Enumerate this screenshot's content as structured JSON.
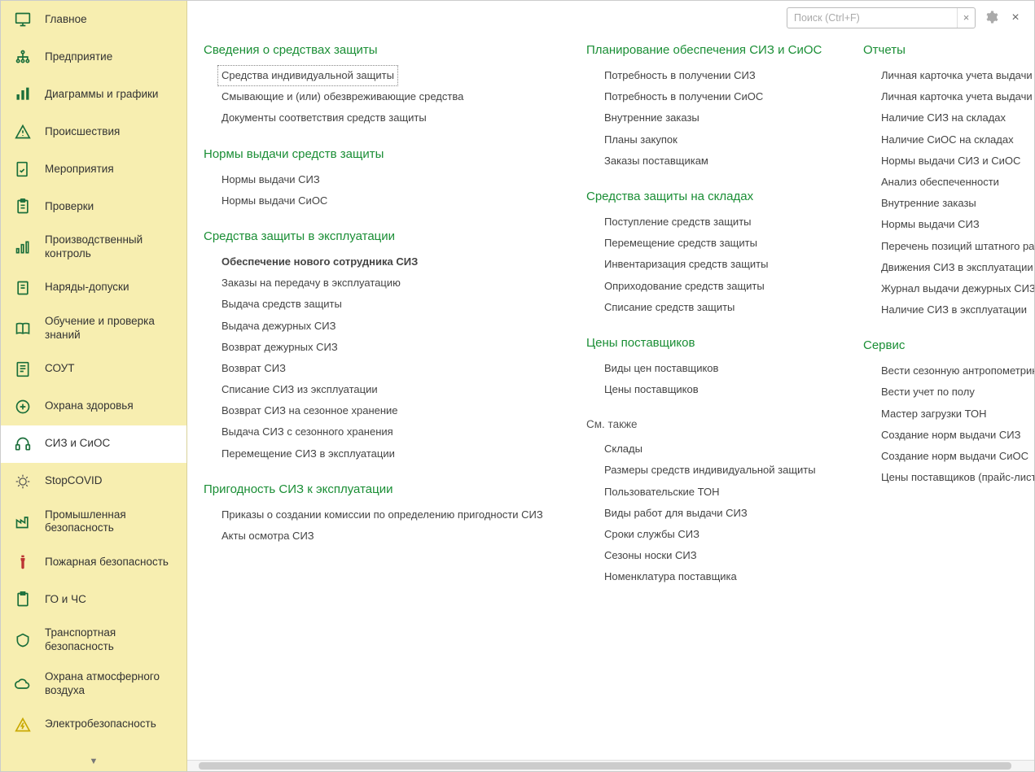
{
  "search": {
    "placeholder": "Поиск (Ctrl+F)"
  },
  "sidebar": {
    "items": [
      {
        "label": "Главное",
        "icon": "monitor"
      },
      {
        "label": "Предприятие",
        "icon": "org"
      },
      {
        "label": "Диаграммы и графики",
        "icon": "chart"
      },
      {
        "label": "Происшествия",
        "icon": "warning"
      },
      {
        "label": "Мероприятия",
        "icon": "doc-check"
      },
      {
        "label": "Проверки",
        "icon": "clipboard"
      },
      {
        "label": "Производственный контроль",
        "icon": "gauge"
      },
      {
        "label": "Наряды-допуски",
        "icon": "permit"
      },
      {
        "label": "Обучение и проверка знаний",
        "icon": "book"
      },
      {
        "label": "СОУТ",
        "icon": "doc-lines"
      },
      {
        "label": "Охрана здоровья",
        "icon": "medical"
      },
      {
        "label": "СИЗ и СиОС",
        "icon": "headset",
        "active": true
      },
      {
        "label": "StopCOVID",
        "icon": "virus"
      },
      {
        "label": "Промышленная безопасность",
        "icon": "industry"
      },
      {
        "label": "Пожарная безопасность",
        "icon": "extinguisher"
      },
      {
        "label": "ГО и ЧС",
        "icon": "civil"
      },
      {
        "label": "Транспортная безопасность",
        "icon": "transport"
      },
      {
        "label": "Охрана атмосферного воздуха",
        "icon": "air"
      },
      {
        "label": "Электробезопасность",
        "icon": "electric"
      }
    ]
  },
  "col1": [
    {
      "title": "Сведения о средствах защиты",
      "items": [
        {
          "label": "Средства индивидуальной защиты",
          "selected": true
        },
        {
          "label": "Смывающие и (или) обезвреживающие средства"
        },
        {
          "label": "Документы соответствия средств защиты"
        }
      ]
    },
    {
      "title": "Нормы выдачи средств защиты",
      "items": [
        {
          "label": "Нормы выдачи СИЗ"
        },
        {
          "label": "Нормы выдачи СиОС"
        }
      ]
    },
    {
      "title": "Средства защиты в эксплуатации",
      "items": [
        {
          "label": "Обеспечение нового сотрудника СИЗ",
          "bold": true
        },
        {
          "label": "Заказы на передачу в эксплуатацию"
        },
        {
          "label": "Выдача средств защиты"
        },
        {
          "label": "Выдача дежурных СИЗ"
        },
        {
          "label": "Возврат дежурных СИЗ"
        },
        {
          "label": "Возврат СИЗ"
        },
        {
          "label": "Списание СИЗ из эксплуатации"
        },
        {
          "label": "Возврат СИЗ на сезонное хранение"
        },
        {
          "label": "Выдача СИЗ с сезонного хранения"
        },
        {
          "label": "Перемещение СИЗ в эксплуатации"
        }
      ]
    },
    {
      "title": "Пригодность СИЗ к эксплуатации",
      "items": [
        {
          "label": "Приказы о создании комиссии по определению пригодности СИЗ"
        },
        {
          "label": "Акты осмотра СИЗ"
        }
      ]
    }
  ],
  "col2": [
    {
      "title": "Планирование обеспечения СИЗ и СиОС",
      "items": [
        {
          "label": "Потребность в получении СИЗ"
        },
        {
          "label": "Потребность в получении СиОС"
        },
        {
          "label": "Внутренние заказы"
        },
        {
          "label": "Планы закупок"
        },
        {
          "label": "Заказы поставщикам"
        }
      ]
    },
    {
      "title": "Средства защиты на складах",
      "items": [
        {
          "label": "Поступление средств защиты"
        },
        {
          "label": "Перемещение средств защиты"
        },
        {
          "label": "Инвентаризация средств защиты"
        },
        {
          "label": "Оприходование средств защиты"
        },
        {
          "label": "Списание средств защиты"
        }
      ]
    },
    {
      "title": "Цены поставщиков",
      "items": [
        {
          "label": "Виды цен поставщиков"
        },
        {
          "label": "Цены поставщиков"
        }
      ]
    },
    {
      "title": "См. также",
      "plain": true,
      "items": [
        {
          "label": "Склады"
        },
        {
          "label": "Размеры средств индивидуальной защиты"
        },
        {
          "label": "Пользовательские ТОН"
        },
        {
          "label": "Виды работ для выдачи СИЗ"
        },
        {
          "label": "Сроки службы СИЗ"
        },
        {
          "label": "Сезоны носки СИЗ"
        },
        {
          "label": "Номенклатура поставщика"
        }
      ]
    }
  ],
  "col3": [
    {
      "title": "Отчеты",
      "items": [
        {
          "label": "Личная карточка учета выдачи С"
        },
        {
          "label": "Личная карточка учета выдачи С"
        },
        {
          "label": "Наличие СИЗ на складах"
        },
        {
          "label": "Наличие СиОС на складах"
        },
        {
          "label": "Нормы выдачи СИЗ и СиОС"
        },
        {
          "label": "Анализ обеспеченности"
        },
        {
          "label": "Внутренние заказы"
        },
        {
          "label": "Нормы выдачи СИЗ"
        },
        {
          "label": "Перечень позиций штатного рас"
        },
        {
          "label": "Движения СИЗ в эксплуатации"
        },
        {
          "label": "Журнал выдачи дежурных СИЗ"
        },
        {
          "label": "Наличие СИЗ в эксплуатации"
        }
      ]
    },
    {
      "title": "Сервис",
      "items": [
        {
          "label": "Вести сезонную антропометрию"
        },
        {
          "label": "Вести учет по полу"
        },
        {
          "label": "Мастер загрузки ТОН"
        },
        {
          "label": "Создание норм выдачи СИЗ"
        },
        {
          "label": "Создание норм выдачи СиОС"
        },
        {
          "label": "Цены поставщиков (прайс-листь"
        }
      ]
    }
  ]
}
